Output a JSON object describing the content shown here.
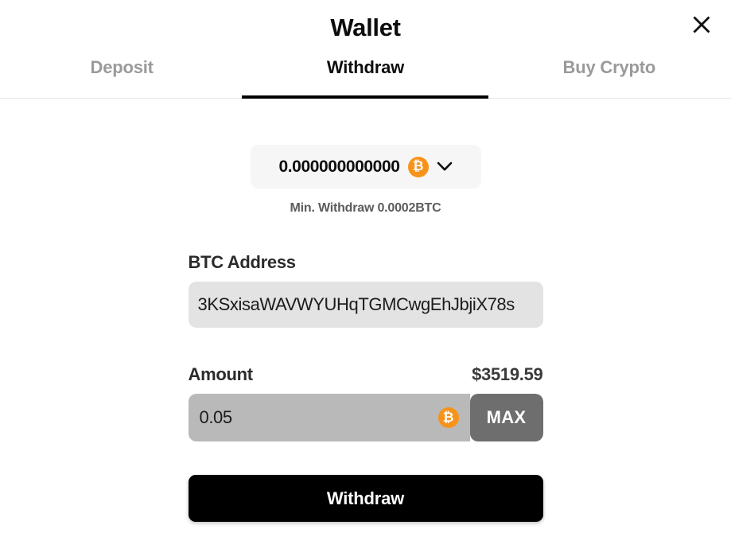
{
  "modal": {
    "title": "Wallet",
    "close_icon": "close-icon"
  },
  "tabs": [
    {
      "label": "Deposit",
      "active": false
    },
    {
      "label": "Withdraw",
      "active": true
    },
    {
      "label": "Buy Crypto",
      "active": false
    }
  ],
  "balance_select": {
    "amount": "0.000000000000",
    "coin_symbol": "₿",
    "coin_icon": "bitcoin-icon",
    "chevron_icon": "chevron-down-icon"
  },
  "min_withdraw_note": "Min. Withdraw 0.0002BTC",
  "address_field": {
    "label": "BTC Address",
    "value": "3KSxisaWAVWYUHqTGMCwgEhJbjiX78s",
    "placeholder": "BTC Address"
  },
  "amount_field": {
    "label": "Amount",
    "fiat_value": "$3519.59",
    "value": "0.05",
    "placeholder": "0.00",
    "coin_symbol": "₿",
    "coin_icon": "bitcoin-icon",
    "max_label": "MAX"
  },
  "submit": {
    "label": "Withdraw"
  },
  "colors": {
    "accent_bitcoin": "#f7931a",
    "active_tab": "#0d0d0d",
    "inactive_tab": "#9a9a9a",
    "submit_bg": "#000000",
    "amount_input_bg": "#b9b9b9",
    "max_button_bg": "#6e6e6e",
    "address_input_bg": "#e3e3e3",
    "select_bg": "#f6f6f6"
  }
}
